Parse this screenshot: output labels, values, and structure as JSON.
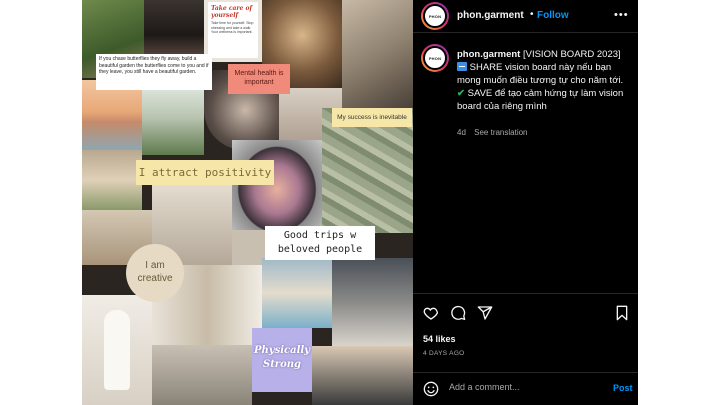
{
  "colors": {
    "accent": "#0095f6",
    "panel_bg": "#000000",
    "text": "#f5f5f5",
    "muted": "#a8a8a8"
  },
  "header": {
    "avatar_text": "PHON",
    "username": "phon.garment",
    "separator": "•",
    "follow_label": "Follow",
    "more_icon": "more-horizontal-icon"
  },
  "caption": {
    "username": "phon.garment",
    "title": "[VISION BOARD 2023]",
    "line1_icon": "share-emoji-icon",
    "line1": "SHARE vision board này nếu bạn mong muốn điều tương tự cho năm tới.",
    "line2_icon": "check-mark-icon",
    "line2": "SAVE để tạo cảm hứng tự làm vision board của riêng mình",
    "age": "4d",
    "see_translation": "See translation"
  },
  "actions": {
    "like_icon": "heart-icon",
    "comment_icon": "comment-icon",
    "share_icon": "send-icon",
    "save_icon": "bookmark-icon",
    "likes": "54 likes",
    "posted": "4 DAYS AGO"
  },
  "comment": {
    "emoji_icon": "emoji-icon",
    "placeholder": "Add a comment...",
    "post_label": "Post"
  },
  "collage": {
    "quote_butterflies": "If you chase butterflies they fly away, build a beautiful garden the butterflies come to you and if they leave, you still have a beautiful garden.",
    "take_care_title": "Take care of yourself",
    "take_care_body": "Take time for yourself. Stop stressing and take a walk. Your wellness is important.",
    "mental_health": "Mental health is important",
    "success": "My success is inevitable",
    "attract": "I attract positivity",
    "good_trips": "Good trips w beloved people",
    "creative": "I am creative",
    "physically": "Physically Strong"
  }
}
